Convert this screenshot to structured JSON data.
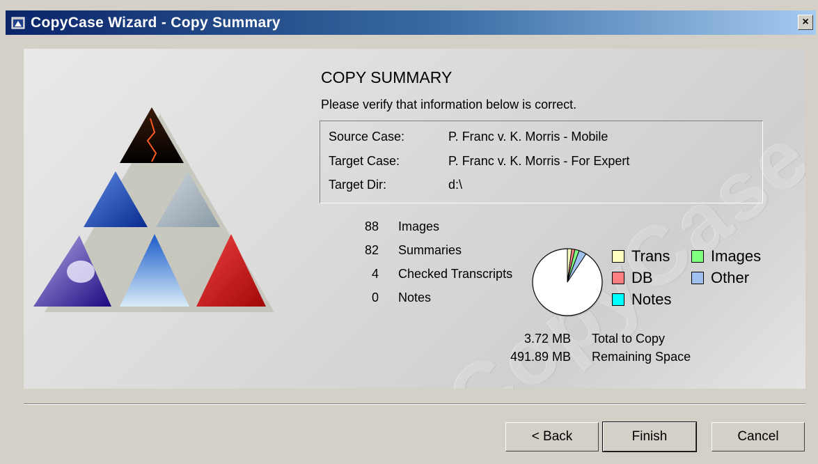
{
  "window": {
    "title": "CopyCase Wizard - Copy Summary",
    "close_label": "×"
  },
  "panel": {
    "watermark": "CopyCase",
    "heading": "COPY SUMMARY",
    "subtitle": "Please verify that information below is correct."
  },
  "case_info": [
    {
      "label": "Source Case:",
      "value": "P. Franc v. K. Morris - Mobile"
    },
    {
      "label": "Target Case:",
      "value": "P. Franc v. K. Morris - For Expert"
    },
    {
      "label": "Target Dir:",
      "value": "d:\\"
    }
  ],
  "counts": [
    {
      "num": "88",
      "label": "Images"
    },
    {
      "num": "82",
      "label": "Summaries"
    },
    {
      "num": "4",
      "label": "Checked Transcripts"
    },
    {
      "num": "0",
      "label": "Notes"
    }
  ],
  "legend": [
    {
      "label": "Trans",
      "color": "#ffffc0"
    },
    {
      "label": "Images",
      "color": "#80ff80"
    },
    {
      "label": "DB",
      "color": "#ff8080"
    },
    {
      "label": "Other",
      "color": "#a0c0f0"
    },
    {
      "label": "Notes",
      "color": "#00ffff"
    }
  ],
  "pie_slices": [
    {
      "name": "Trans",
      "fraction": 0.02,
      "color": "#ffffc0"
    },
    {
      "name": "DB",
      "fraction": 0.015,
      "color": "#ff8080"
    },
    {
      "name": "Images",
      "fraction": 0.02,
      "color": "#80ff80"
    },
    {
      "name": "Other",
      "fraction": 0.035,
      "color": "#a0c0f0"
    },
    {
      "name": "Notes",
      "fraction": 0.0,
      "color": "#00ffff"
    }
  ],
  "sizes": [
    {
      "num": "3.72 MB",
      "label": "Total to Copy"
    },
    {
      "num": "491.89 MB",
      "label": "Remaining Space"
    }
  ],
  "buttons": {
    "back": "< Back",
    "finish": "Finish",
    "cancel": "Cancel"
  }
}
